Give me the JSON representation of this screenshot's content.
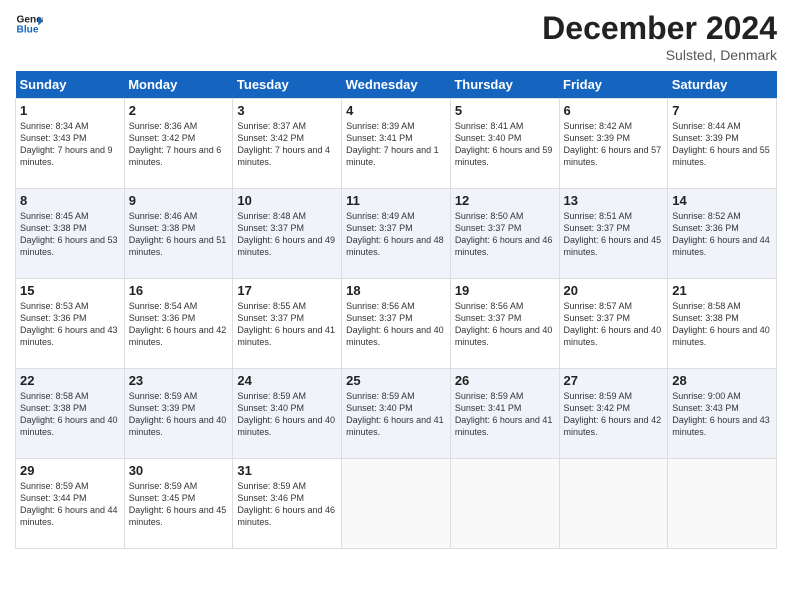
{
  "logo": {
    "line1": "General",
    "line2": "Blue"
  },
  "title": "December 2024",
  "location": "Sulsted, Denmark",
  "days_header": [
    "Sunday",
    "Monday",
    "Tuesday",
    "Wednesday",
    "Thursday",
    "Friday",
    "Saturday"
  ],
  "weeks": [
    [
      {
        "day": "1",
        "sunrise": "8:34 AM",
        "sunset": "3:43 PM",
        "daylight": "7 hours and 9 minutes."
      },
      {
        "day": "2",
        "sunrise": "8:36 AM",
        "sunset": "3:42 PM",
        "daylight": "7 hours and 6 minutes."
      },
      {
        "day": "3",
        "sunrise": "8:37 AM",
        "sunset": "3:42 PM",
        "daylight": "7 hours and 4 minutes."
      },
      {
        "day": "4",
        "sunrise": "8:39 AM",
        "sunset": "3:41 PM",
        "daylight": "7 hours and 1 minute."
      },
      {
        "day": "5",
        "sunrise": "8:41 AM",
        "sunset": "3:40 PM",
        "daylight": "6 hours and 59 minutes."
      },
      {
        "day": "6",
        "sunrise": "8:42 AM",
        "sunset": "3:39 PM",
        "daylight": "6 hours and 57 minutes."
      },
      {
        "day": "7",
        "sunrise": "8:44 AM",
        "sunset": "3:39 PM",
        "daylight": "6 hours and 55 minutes."
      }
    ],
    [
      {
        "day": "8",
        "sunrise": "8:45 AM",
        "sunset": "3:38 PM",
        "daylight": "6 hours and 53 minutes."
      },
      {
        "day": "9",
        "sunrise": "8:46 AM",
        "sunset": "3:38 PM",
        "daylight": "6 hours and 51 minutes."
      },
      {
        "day": "10",
        "sunrise": "8:48 AM",
        "sunset": "3:37 PM",
        "daylight": "6 hours and 49 minutes."
      },
      {
        "day": "11",
        "sunrise": "8:49 AM",
        "sunset": "3:37 PM",
        "daylight": "6 hours and 48 minutes."
      },
      {
        "day": "12",
        "sunrise": "8:50 AM",
        "sunset": "3:37 PM",
        "daylight": "6 hours and 46 minutes."
      },
      {
        "day": "13",
        "sunrise": "8:51 AM",
        "sunset": "3:37 PM",
        "daylight": "6 hours and 45 minutes."
      },
      {
        "day": "14",
        "sunrise": "8:52 AM",
        "sunset": "3:36 PM",
        "daylight": "6 hours and 44 minutes."
      }
    ],
    [
      {
        "day": "15",
        "sunrise": "8:53 AM",
        "sunset": "3:36 PM",
        "daylight": "6 hours and 43 minutes."
      },
      {
        "day": "16",
        "sunrise": "8:54 AM",
        "sunset": "3:36 PM",
        "daylight": "6 hours and 42 minutes."
      },
      {
        "day": "17",
        "sunrise": "8:55 AM",
        "sunset": "3:37 PM",
        "daylight": "6 hours and 41 minutes."
      },
      {
        "day": "18",
        "sunrise": "8:56 AM",
        "sunset": "3:37 PM",
        "daylight": "6 hours and 40 minutes."
      },
      {
        "day": "19",
        "sunrise": "8:56 AM",
        "sunset": "3:37 PM",
        "daylight": "6 hours and 40 minutes."
      },
      {
        "day": "20",
        "sunrise": "8:57 AM",
        "sunset": "3:37 PM",
        "daylight": "6 hours and 40 minutes."
      },
      {
        "day": "21",
        "sunrise": "8:58 AM",
        "sunset": "3:38 PM",
        "daylight": "6 hours and 40 minutes."
      }
    ],
    [
      {
        "day": "22",
        "sunrise": "8:58 AM",
        "sunset": "3:38 PM",
        "daylight": "6 hours and 40 minutes."
      },
      {
        "day": "23",
        "sunrise": "8:59 AM",
        "sunset": "3:39 PM",
        "daylight": "6 hours and 40 minutes."
      },
      {
        "day": "24",
        "sunrise": "8:59 AM",
        "sunset": "3:40 PM",
        "daylight": "6 hours and 40 minutes."
      },
      {
        "day": "25",
        "sunrise": "8:59 AM",
        "sunset": "3:40 PM",
        "daylight": "6 hours and 41 minutes."
      },
      {
        "day": "26",
        "sunrise": "8:59 AM",
        "sunset": "3:41 PM",
        "daylight": "6 hours and 41 minutes."
      },
      {
        "day": "27",
        "sunrise": "8:59 AM",
        "sunset": "3:42 PM",
        "daylight": "6 hours and 42 minutes."
      },
      {
        "day": "28",
        "sunrise": "9:00 AM",
        "sunset": "3:43 PM",
        "daylight": "6 hours and 43 minutes."
      }
    ],
    [
      {
        "day": "29",
        "sunrise": "8:59 AM",
        "sunset": "3:44 PM",
        "daylight": "6 hours and 44 minutes."
      },
      {
        "day": "30",
        "sunrise": "8:59 AM",
        "sunset": "3:45 PM",
        "daylight": "6 hours and 45 minutes."
      },
      {
        "day": "31",
        "sunrise": "8:59 AM",
        "sunset": "3:46 PM",
        "daylight": "6 hours and 46 minutes."
      },
      null,
      null,
      null,
      null
    ]
  ]
}
